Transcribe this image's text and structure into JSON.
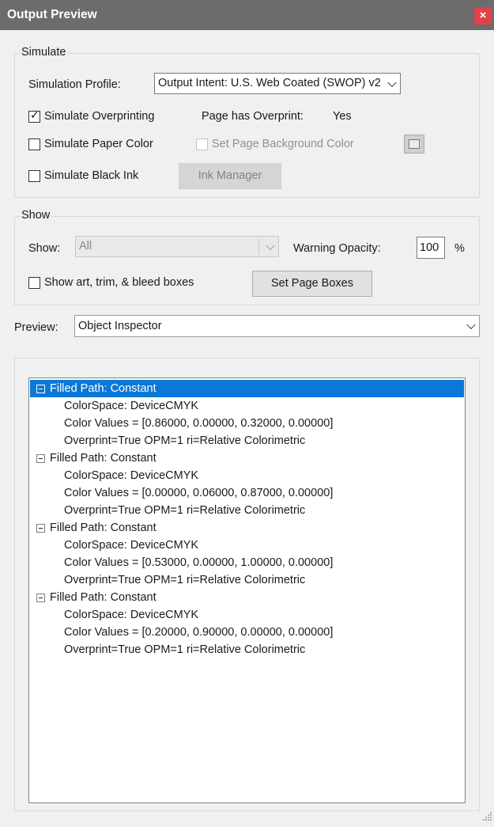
{
  "window": {
    "title": "Output Preview",
    "close_glyph": "×"
  },
  "simulate": {
    "legend": "Simulate",
    "profile_label": "Simulation Profile:",
    "profile_value": "Output Intent: U.S. Web Coated (SWOP) v2",
    "overprint_label": "Simulate Overprinting",
    "overprint_checked": true,
    "page_overprint_label": "Page has Overprint:",
    "page_overprint_value": "Yes",
    "paper_color_label": "Simulate Paper Color",
    "page_bg_label": "Set Page Background Color",
    "swatch_color": "#ecebdf",
    "black_ink_label": "Simulate Black Ink",
    "ink_manager_label": "Ink Manager"
  },
  "show": {
    "legend": "Show",
    "show_label": "Show:",
    "show_value": "All",
    "warning_label": "Warning Opacity:",
    "warning_value": "100",
    "warning_unit": "%",
    "boxes_label": "Show art, trim, & bleed boxes",
    "set_boxes_label": "Set Page Boxes"
  },
  "preview": {
    "label": "Preview:",
    "value": "Object Inspector"
  },
  "tree": {
    "selected_color": "#0a78d7",
    "items": [
      {
        "title": "Filled Path: Constant",
        "colorspace": "ColorSpace: DeviceCMYK",
        "values": "Color Values = [0.86000, 0.00000, 0.32000, 0.00000]",
        "overprint": "Overprint=True OPM=1 ri=Relative Colorimetric"
      },
      {
        "title": "Filled Path: Constant",
        "colorspace": "ColorSpace: DeviceCMYK",
        "values": "Color Values = [0.00000, 0.06000, 0.87000, 0.00000]",
        "overprint": "Overprint=True OPM=1 ri=Relative Colorimetric"
      },
      {
        "title": "Filled Path: Constant",
        "colorspace": "ColorSpace: DeviceCMYK",
        "values": "Color Values = [0.53000, 0.00000, 1.00000, 0.00000]",
        "overprint": "Overprint=True OPM=1 ri=Relative Colorimetric"
      },
      {
        "title": "Filled Path: Constant",
        "colorspace": "ColorSpace: DeviceCMYK",
        "values": "Color Values = [0.20000, 0.90000, 0.00000, 0.00000]",
        "overprint": "Overprint=True OPM=1 ri=Relative Colorimetric"
      }
    ]
  }
}
